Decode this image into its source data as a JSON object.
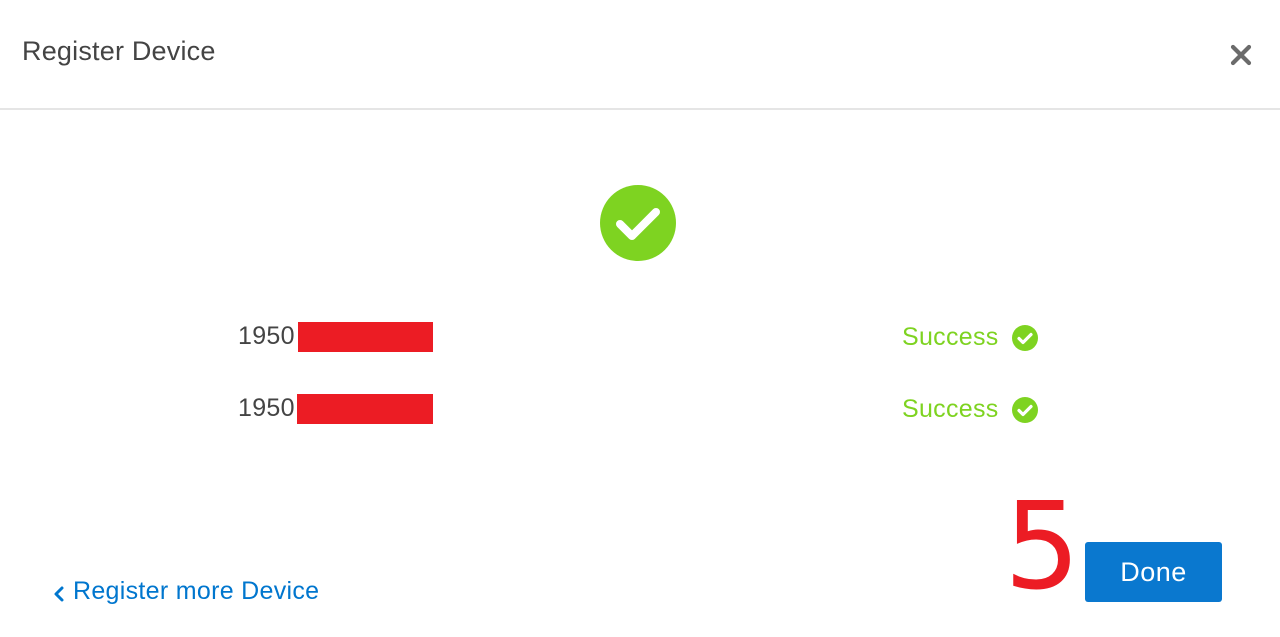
{
  "dialog": {
    "title": "Register Device",
    "close_icon": "close-icon"
  },
  "result": {
    "icon": "success-check-circle-icon",
    "color": "#7ed321"
  },
  "devices": [
    {
      "serial_prefix": "1950",
      "status": "Success",
      "status_icon": "check-circle-icon"
    },
    {
      "serial_prefix": "1950",
      "status": "Success",
      "status_icon": "check-circle-icon"
    }
  ],
  "footer": {
    "back_link": "Register more Device",
    "back_icon": "chevron-left-icon",
    "annotation_number": "5",
    "done_label": "Done"
  },
  "colors": {
    "accent_blue": "#0a78cf",
    "link_blue": "#0076ce",
    "success_green": "#7ed321",
    "annotation_red": "#ec1c24"
  }
}
